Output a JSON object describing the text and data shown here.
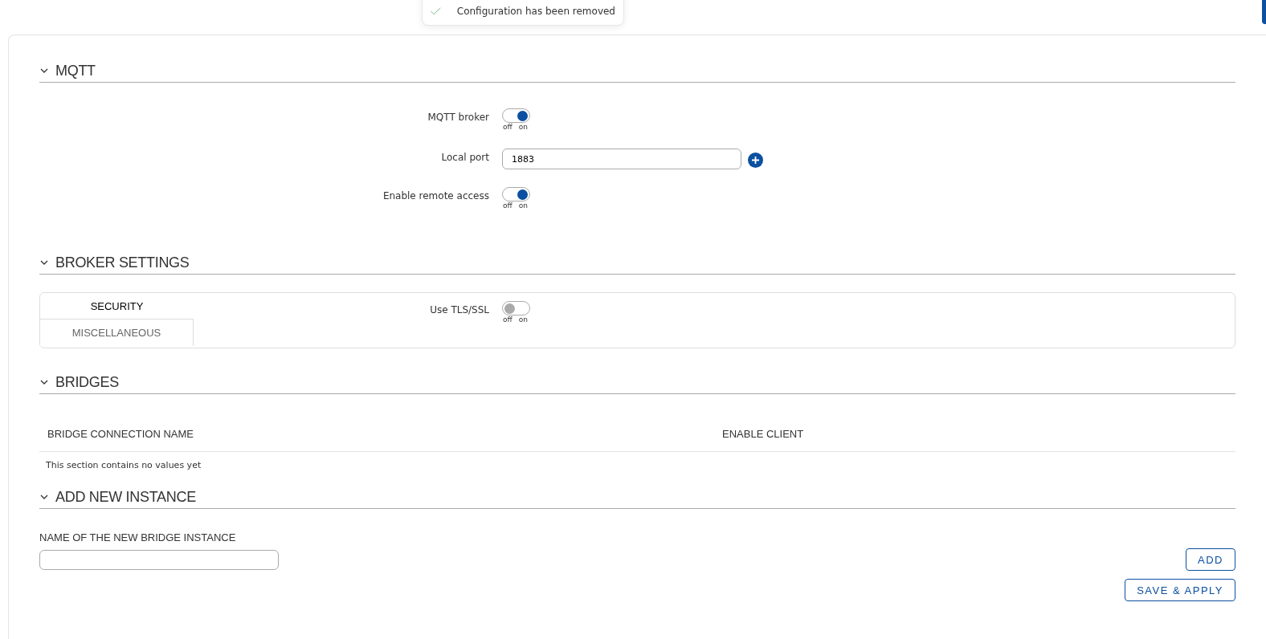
{
  "toast": {
    "message": "Configuration has been removed"
  },
  "sections": [
    {
      "kind": "form",
      "title": "MQTT",
      "expanded": true,
      "rows": [
        {
          "kind": "toggle",
          "label": "MQTT broker",
          "on": true,
          "off_label": "off",
          "on_label": "on"
        },
        {
          "kind": "input",
          "label": "Local port",
          "value": "1883"
        },
        {
          "kind": "toggle",
          "label": "Enable remote access",
          "on": true,
          "off_label": "off",
          "on_label": "on"
        }
      ]
    },
    {
      "kind": "tabs",
      "title": "BROKER SETTINGS",
      "expanded": true,
      "tabs": [
        {
          "label": "SECURITY",
          "selected": true
        },
        {
          "label": "MISCELLANEOUS",
          "selected": false
        }
      ],
      "rows": [
        {
          "kind": "toggle",
          "label": "Use TLS/SSL",
          "on": false,
          "off_label": "off",
          "on_label": "on"
        }
      ]
    },
    {
      "kind": "table",
      "title": "BRIDGES",
      "expanded": true,
      "columns": [
        "BRIDGE CONNECTION NAME",
        "ENABLE CLIENT"
      ],
      "empty_text": "This section contains no values yet"
    },
    {
      "kind": "add",
      "title": "ADD NEW INSTANCE",
      "expanded": true,
      "field_label": "NAME OF THE NEW BRIDGE INSTANCE",
      "add_button": "ADD"
    }
  ],
  "save_button": "SAVE & APPLY"
}
